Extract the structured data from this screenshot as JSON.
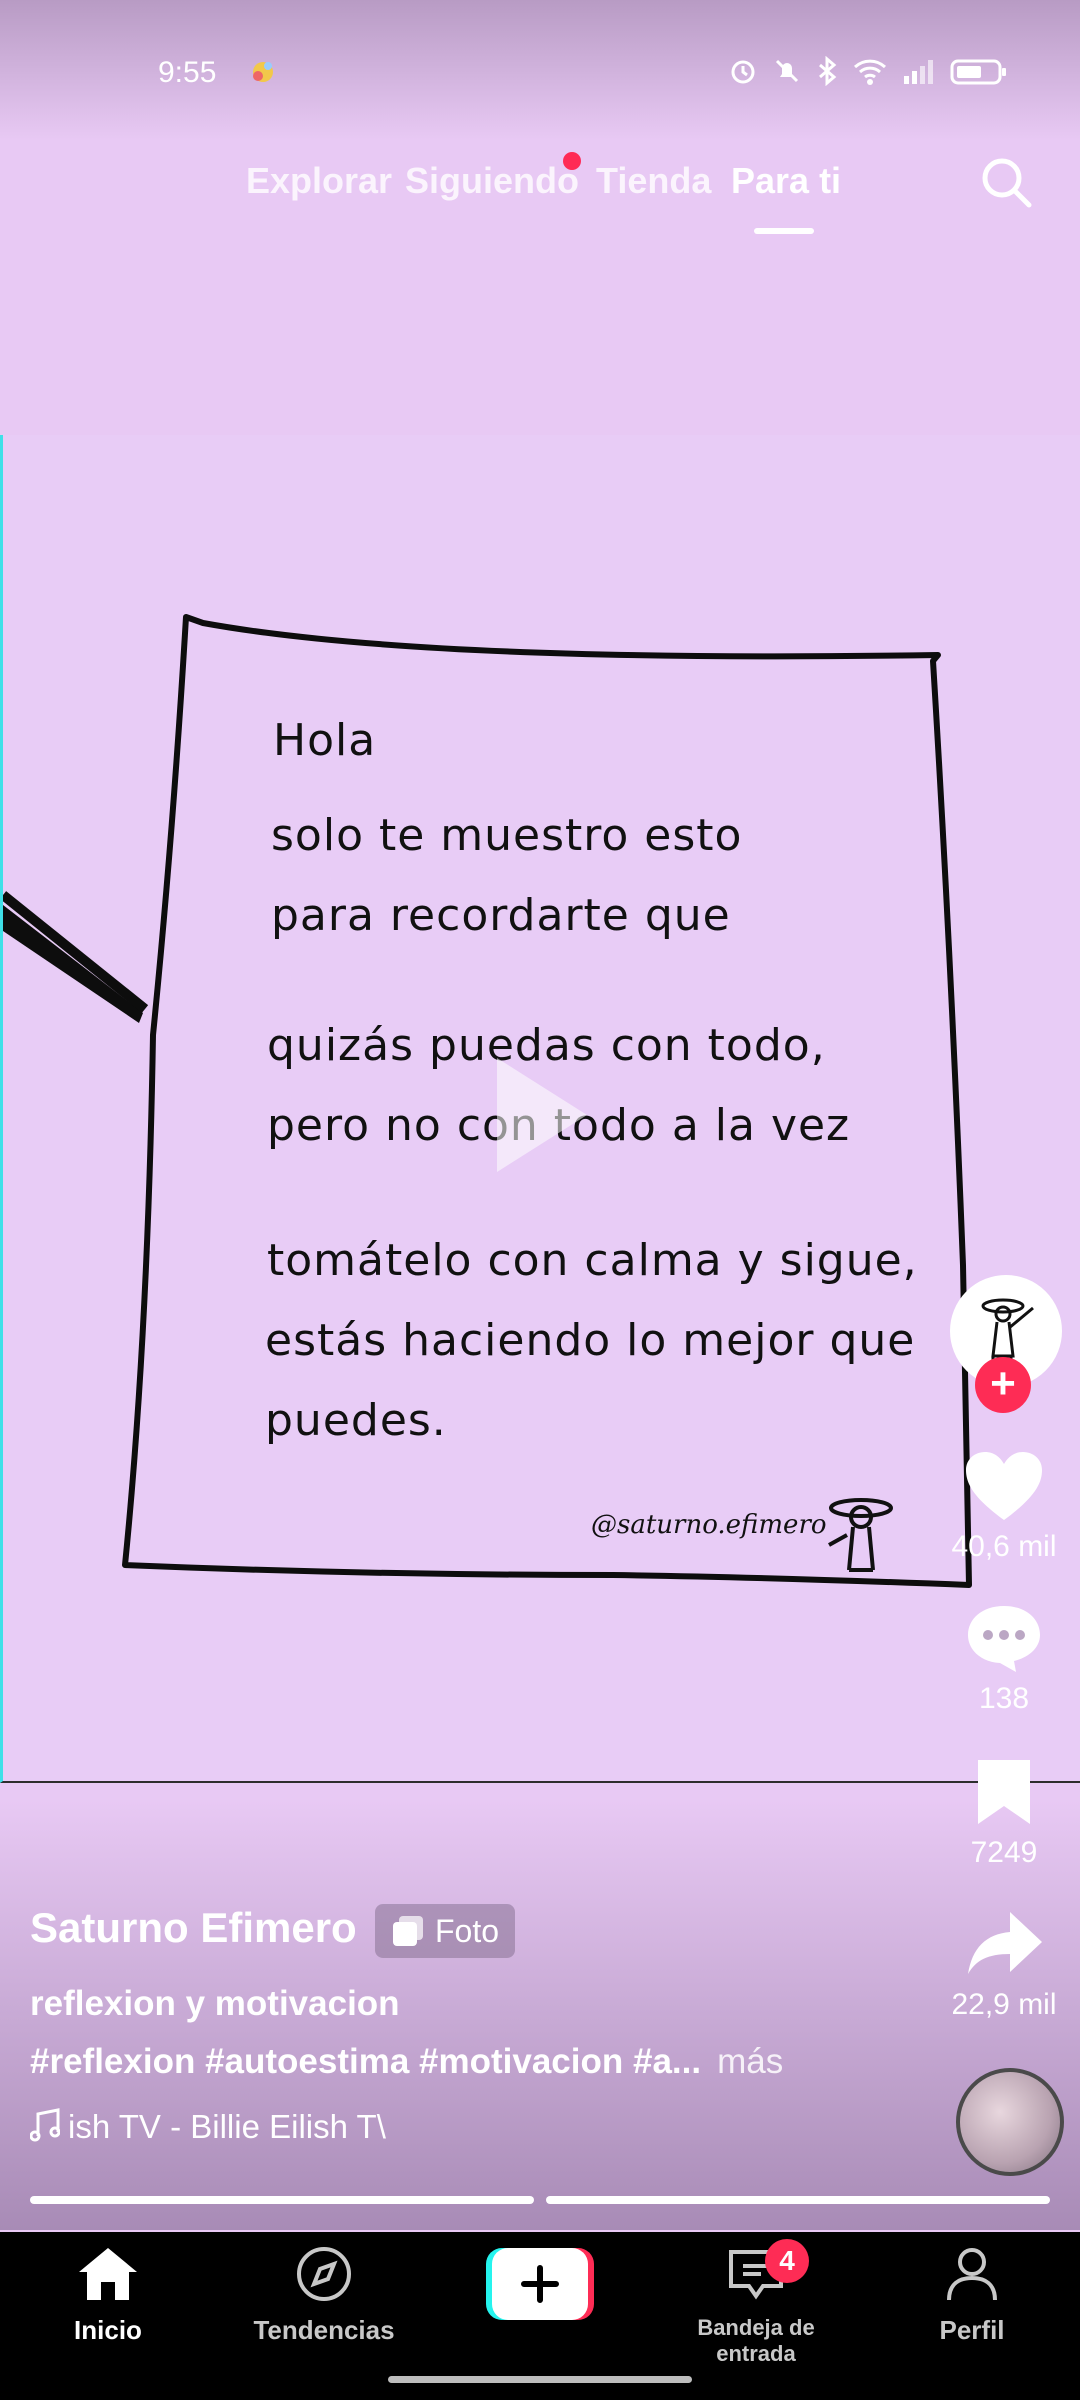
{
  "status_bar": {
    "time": "9:55"
  },
  "top_nav": {
    "tabs": [
      {
        "label": "Explorar"
      },
      {
        "label": "Siguiendo"
      },
      {
        "label": "Tienda"
      },
      {
        "label": "Para ti"
      }
    ],
    "active_tab": "Para ti",
    "search_icon": "search-icon"
  },
  "note": {
    "lines": [
      "Hola",
      "solo te muestro esto",
      "para recordarte que",
      "quizás puedas con  todo,",
      "pero no con todo a la vez",
      "tomátelo con calma  y sigue,",
      "estás haciendo lo mejor que",
      "puedes."
    ],
    "signature": "@saturno.efimero"
  },
  "rail": {
    "like_count": "40,6 mil",
    "comment_count": "138",
    "save_count": "7249",
    "share_count": "22,9 mil"
  },
  "caption": {
    "author": "Saturno Efimero",
    "badge": "Foto",
    "description": "reflexion y motivacion",
    "hashtags": "#reflexion #autoestima #motivacion #a...",
    "more": "más",
    "music": "ish    TV - Billie Eilish    T\\"
  },
  "bottom_nav": {
    "items": [
      {
        "label": "Inicio"
      },
      {
        "label": "Tendencias"
      },
      {
        "label": "Bandeja de entrada"
      },
      {
        "label": "Perfil"
      }
    ],
    "inbox_badge": "4"
  },
  "colors": {
    "background": "#e8c9f4",
    "accent": "#fe2c55",
    "nav_bg": "#000000"
  }
}
